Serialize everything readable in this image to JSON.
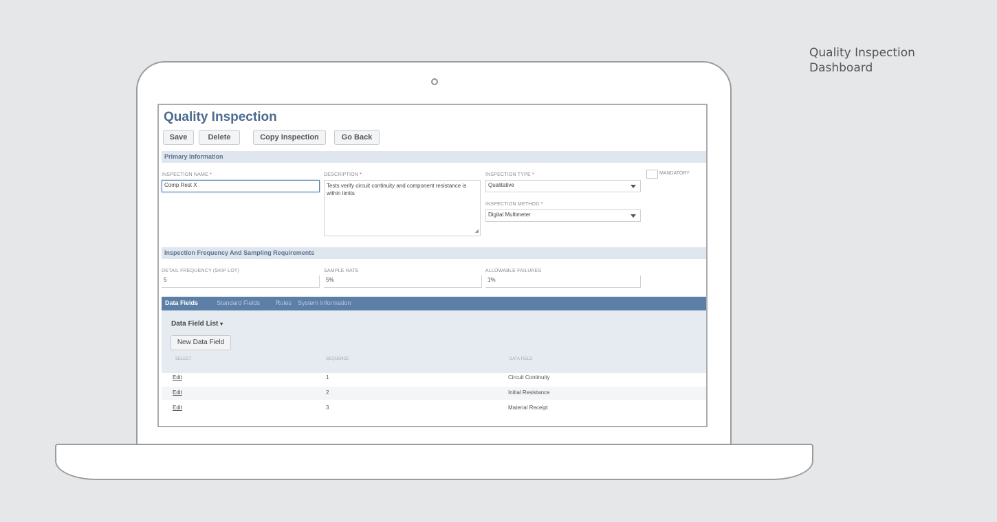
{
  "caption": "Quality Inspection\nDashboard",
  "page": {
    "title": "Quality Inspection",
    "buttons": {
      "save": "Save",
      "delete": "Delete",
      "copy": "Copy Inspection",
      "back": "Go Back"
    }
  },
  "primary": {
    "section_title": "Primary Information",
    "inspection_name": {
      "label": "INSPECTION NAME",
      "required": "*",
      "value": "Comp Rest X"
    },
    "description": {
      "label": "DESCRIPTION",
      "required": "*",
      "value": "Tests verify circuit continuity and component resistance is within limits"
    },
    "inspection_type": {
      "label": "INSPECTION TYPE",
      "required": "*",
      "value": "Qualitative"
    },
    "inspection_method": {
      "label": "INSPECTION METHOD",
      "required": "*",
      "value": "Digital Multimeter"
    },
    "mandatory": {
      "label": "MANDATORY"
    }
  },
  "frequency": {
    "section_title": "Inspection Frequency And Sampling Requirements",
    "detail_frequency": {
      "label": "DETAIL FREQUENCY (SKIP LOT)",
      "value": "5"
    },
    "sample_rate": {
      "label": "SAMPLE RATE",
      "value": "5%"
    },
    "allowable_failures": {
      "label": "ALLOWABLE FAILURES",
      "value": "1%"
    }
  },
  "tabs": [
    "Data Fields",
    "Standard Fields",
    "Rules",
    "System Information"
  ],
  "data_fields": {
    "list_title": "Data Field List",
    "list_title_caret": "▾",
    "new_button": "New Data Field",
    "columns": [
      "SELECT",
      "SEQUENCE",
      "DATA FIELD"
    ],
    "rows": [
      {
        "select": "Edit",
        "sequence": "1",
        "field": "Circuit Continuity"
      },
      {
        "select": "Edit",
        "sequence": "2",
        "field": "Initial Resistance"
      },
      {
        "select": "Edit",
        "sequence": "3",
        "field": "Material Receipt"
      }
    ]
  }
}
